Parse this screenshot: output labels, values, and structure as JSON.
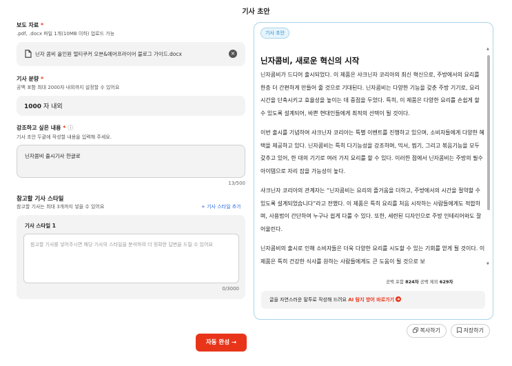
{
  "page": {
    "title": "기사 초안"
  },
  "form": {
    "press": {
      "label": "보도 자료",
      "required_mark": "*",
      "help": ".pdf, .docx 파일 1개(10MB 이하) 업로드 가능",
      "file_name": "닌자 콤비 올인원 멀티쿠커 오븐&에어프라이어 블로그 가이드.docx",
      "file_icon": "document-icon",
      "clear_icon": "close-icon",
      "clear_glyph": "×"
    },
    "length": {
      "label": "기사 분량",
      "required_mark": "*",
      "help": "공백 포함 최대 2000자 내외까지 설정할 수 있어요",
      "value": "1000",
      "unit": "자 내외"
    },
    "emphasis": {
      "label": "강조하고 싶은 내용",
      "required_mark": "*",
      "info_glyph": "ⓘ",
      "help": "기사 초안 두괄에 작성할 내용을 입력해 주세요.",
      "value": "닌자콤비 출시기사 한글로",
      "count": "13/500"
    },
    "reference": {
      "label": "참고할 기사 스타일",
      "help": "참고할 기사는 최대 3개까지 넣을 수 있어요",
      "add_label": "+ 기사 스타일 추가",
      "card_title": "기사 스타일 1",
      "placeholder": "참고할 기사를 넣어주시면 해당 기사의 스타일을 분석하여 더 정확한 답변을 드릴 수 있어요",
      "count": "0/3000"
    },
    "submit_label": "자동 완성 →"
  },
  "article": {
    "badge": "기사 초안",
    "title": "닌자콤비, 새로운 혁신의 시작",
    "paragraphs": [
      "닌자콤비가 드디어 출시되었다. 이 제품은 샤크닌자 코리아의 최신 혁신으로, 주방에서의 요리를 한층 더 간편하게 만들어 줄 것으로 기대된다. 닌자콤비는 다양한 기능을 갖춘 주방 기기로, 요리 시간을 단축시키고 효율성을 높이는 데 중점을 두었다. 특히, 이 제품은 다양한 요리를 손쉽게 할 수 있도록 설계되어, 바쁜 현대인들에게 최적의 선택이 될 것이다.",
      "이번 출시를 기념하여 샤크닌자 코리아는 특별 이벤트를 진행하고 있으며, 소비자들에게 다양한 혜택을 제공하고 있다. 닌자콤비는 특히 다기능성을 강조하며, 믹서, 찜기, 그리고 볶음기능을 모두 갖추고 있어, 한 대의 기기로 여러 가지 요리를 할 수 있다. 이러한 점에서 닌자콤비는 주방의 필수 아이템으로 자리 잡을 가능성이 높다.",
      "샤크닌자 코리아의 관계자는 “닌자콤비는 요리의 즐거움을 더하고, 주방에서의 시간을 절약할 수 있도록 설계되었습니다”라고 전했다. 이 제품은 특히 요리를 처음 시작하는 사람들에게도 적합하며, 사용법이 간단하여 누구나 쉽게 다룰 수 있다. 또한, 세련된 디자인으로 주방 인테리어와도 잘 어울린다.",
      "닌자콤비의 출시로 인해 소비자들은 더욱 다양한 요리를 시도할 수 있는 기회를 얻게 될 것이다. 이 제품은 특히 건강한 식사를 원하는 사람들에게도 큰 도움이 될 것으로 보"
    ],
    "stats": {
      "with_space_label": "공백 포함",
      "with_space_value": "824자",
      "without_space_label": "공백 제외",
      "without_space_value": "629자"
    },
    "notice_text": "글을 자연스러운 말투로 작성해 드려요",
    "notice_link": "AI 탐지 방어 바로가기",
    "notice_link_icon": "arrow-circle-icon",
    "copy_label": "복사하기",
    "copy_icon": "copy-icon",
    "save_label": "저장하기",
    "save_icon": "bookmark-icon"
  },
  "colors": {
    "accent": "#e8351a",
    "link": "#2f6bde",
    "panel_border": "#a9d3ea"
  }
}
